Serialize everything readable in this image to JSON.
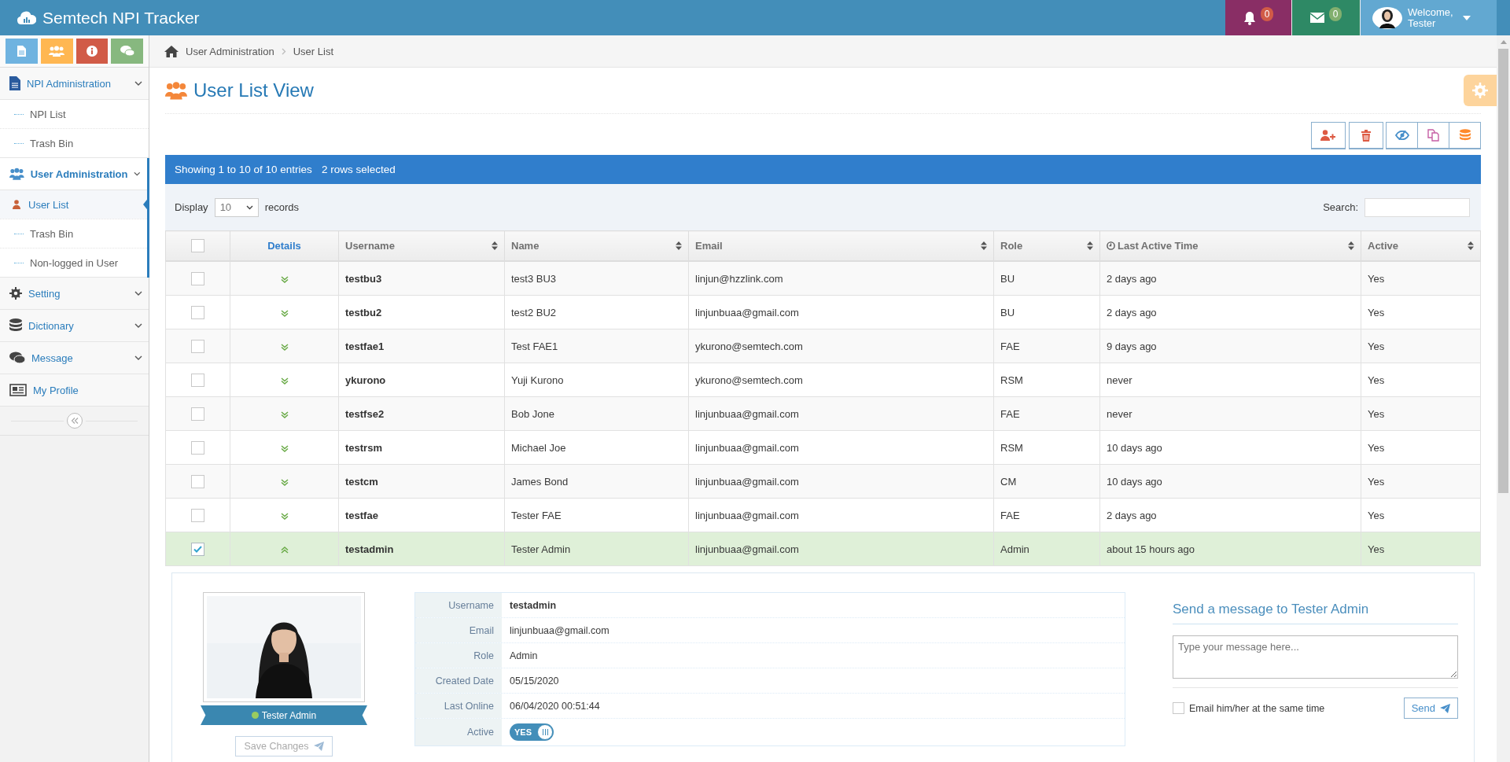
{
  "app": {
    "title": "Semtech NPI Tracker"
  },
  "header": {
    "notifications": {
      "count": "0"
    },
    "messages": {
      "count": "0"
    },
    "user": {
      "greeting": "Welcome,",
      "name": "Tester"
    }
  },
  "sidebar": {
    "menu": [
      {
        "label": "NPI Administration",
        "kind": "menu",
        "selected": false,
        "children": [
          {
            "label": "NPI List",
            "selected": false
          },
          {
            "label": "Trash Bin",
            "selected": false
          }
        ]
      },
      {
        "label": "User Administration",
        "kind": "menu",
        "selected": true,
        "children": [
          {
            "label": "User List",
            "selected": true
          },
          {
            "label": "Trash Bin",
            "selected": false
          },
          {
            "label": "Non-logged in User",
            "selected": false
          }
        ]
      },
      {
        "label": "Setting",
        "kind": "menu",
        "selected": false
      },
      {
        "label": "Dictionary",
        "kind": "menu",
        "selected": false
      },
      {
        "label": "Message",
        "kind": "menu",
        "selected": false
      },
      {
        "label": "My Profile",
        "kind": "link",
        "selected": false
      }
    ]
  },
  "breadcrumb": [
    "User Administration",
    "User List"
  ],
  "page": {
    "title": "User List View"
  },
  "table": {
    "info": "Showing 1 to 10 of 10 entries",
    "selection": "2 rows selected",
    "length_label": "Display",
    "length_value": "10",
    "length_suffix": "records",
    "search_label": "Search:",
    "all_checked": false,
    "columns": [
      {
        "label": "Details",
        "kind": "link"
      },
      {
        "label": "Username",
        "kind": "sort"
      },
      {
        "label": "Name",
        "kind": "sort"
      },
      {
        "label": "Email",
        "kind": "sort"
      },
      {
        "label": "Role",
        "kind": "sort"
      },
      {
        "label": "Last Active Time",
        "kind": "time"
      },
      {
        "label": "Active",
        "kind": "sort"
      }
    ],
    "rows": [
      {
        "selected": false,
        "expanded": false,
        "username": "testbu3",
        "name": "test3 BU3",
        "email": "linjun@hzzlink.com",
        "role": "BU",
        "last_active": "2 days ago",
        "active": "Yes"
      },
      {
        "selected": false,
        "expanded": false,
        "username": "testbu2",
        "name": "test2 BU2",
        "email": "linjunbuaa@gmail.com",
        "role": "BU",
        "last_active": "2 days ago",
        "active": "Yes"
      },
      {
        "selected": false,
        "expanded": false,
        "username": "testfae1",
        "name": "Test FAE1",
        "email": "ykurono@semtech.com",
        "role": "FAE",
        "last_active": "9 days ago",
        "active": "Yes"
      },
      {
        "selected": false,
        "expanded": false,
        "username": "ykurono",
        "name": "Yuji Kurono",
        "email": "ykurono@semtech.com",
        "role": "RSM",
        "last_active": "never",
        "active": "Yes"
      },
      {
        "selected": false,
        "expanded": false,
        "username": "testfse2",
        "name": "Bob Jone",
        "email": "linjunbuaa@gmail.com",
        "role": "FAE",
        "last_active": "never",
        "active": "Yes"
      },
      {
        "selected": false,
        "expanded": false,
        "username": "testrsm",
        "name": "Michael Joe",
        "email": "linjunbuaa@gmail.com",
        "role": "RSM",
        "last_active": "10 days ago",
        "active": "Yes"
      },
      {
        "selected": false,
        "expanded": false,
        "username": "testcm",
        "name": "James Bond",
        "email": "linjunbuaa@gmail.com",
        "role": "CM",
        "last_active": "10 days ago",
        "active": "Yes"
      },
      {
        "selected": false,
        "expanded": false,
        "username": "testfae",
        "name": "Tester FAE",
        "email": "linjunbuaa@gmail.com",
        "role": "FAE",
        "last_active": "2 days ago",
        "active": "Yes"
      },
      {
        "selected": true,
        "expanded": true,
        "username": "testadmin",
        "name": "Tester Admin",
        "email": "linjunbuaa@gmail.com",
        "role": "Admin",
        "last_active": "about 15 hours ago",
        "active": "Yes"
      }
    ]
  },
  "detail": {
    "name_tag": "Tester Admin",
    "online": true,
    "save_button": {
      "label": "Save Changes",
      "disabled": true
    },
    "fields": [
      {
        "label": "Username",
        "value": "testadmin",
        "kind": "bold"
      },
      {
        "label": "Email",
        "value": "linjunbuaa@gmail.com",
        "kind": "text"
      },
      {
        "label": "Role",
        "value": "Admin",
        "kind": "text"
      },
      {
        "label": "Created Date",
        "value": "05/15/2020",
        "kind": "text"
      },
      {
        "label": "Last Online",
        "value": "06/04/2020 00:51:44",
        "kind": "text"
      }
    ],
    "active": {
      "label": "Active",
      "on": true,
      "text": "YES"
    },
    "message": {
      "title": "Send a message to Tester Admin",
      "placeholder": "Type your message here...",
      "email_option": {
        "label": "Email him/her at the same time",
        "checked": false
      },
      "send_button": "Send"
    }
  }
}
